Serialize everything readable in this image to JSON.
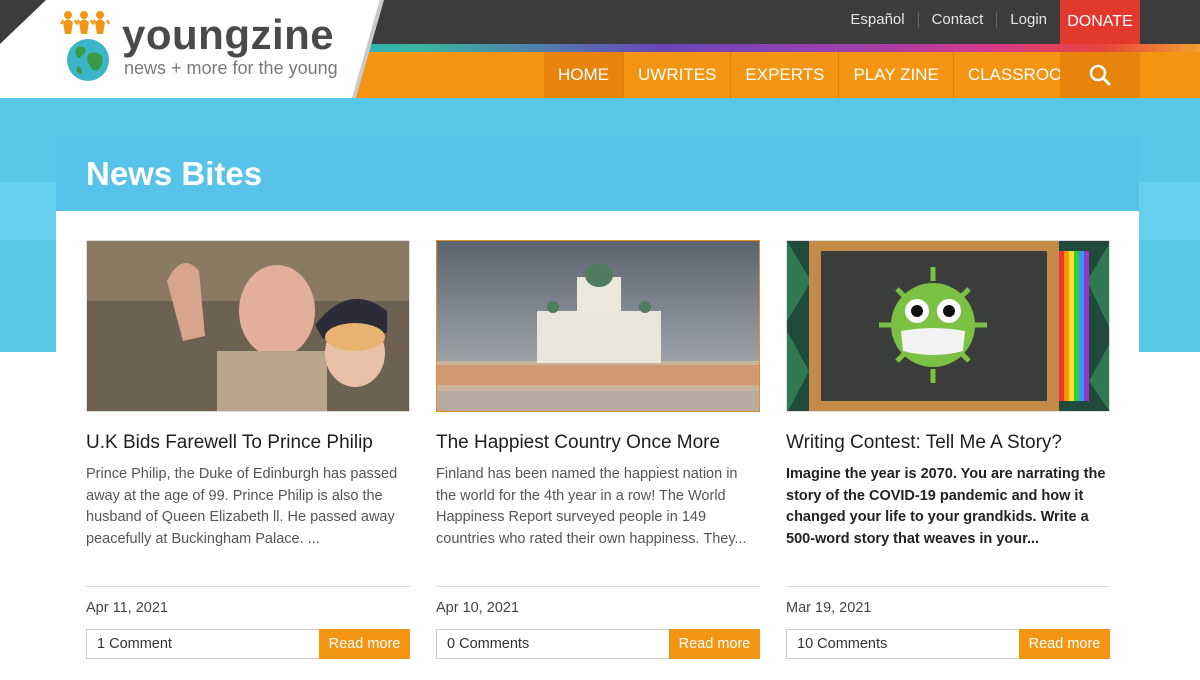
{
  "brand": {
    "name_part1": "young",
    "name_part2": "zine",
    "tagline": "news + more for the young"
  },
  "top_links": [
    "Español",
    "Contact",
    "Login"
  ],
  "donate_label": "DONATE",
  "nav": {
    "items": [
      "HOME",
      "UWRITES",
      "EXPERTS",
      "PLAY ZINE",
      "CLASSROOM"
    ],
    "active": "HOME",
    "search_icon": "search-icon"
  },
  "section": {
    "title": "News Bites"
  },
  "cards": [
    {
      "title": "U.K Bids Farewell To Prince Philip",
      "excerpt": "Prince Philip, the Duke of Edinburgh has passed away at the age of 99. Prince Philip is also the husband of Queen Elizabeth ll. He passed away peacefully at Buckingham Palace. ...",
      "date": "Apr 11, 2021",
      "comments": "1 Comment",
      "read_more": "Read more"
    },
    {
      "title": "The Happiest Country Once More",
      "excerpt": "Finland has been named the happiest nation in the world for the 4th year in a row! The World Happiness Report surveyed people in 149 countries who rated their own happiness. They...",
      "date": "Apr 10, 2021",
      "comments": "0 Comments",
      "read_more": "Read more"
    },
    {
      "title": "Writing Contest: Tell Me A Story?",
      "excerpt": "Imagine the year is 2070. You are narrating the story of the COVID-19 pandemic and how it changed your life to your grandkids. Write a 500-word story that weaves in your...",
      "date": "Mar 19, 2021",
      "comments": "10 Comments",
      "read_more": "Read more"
    }
  ],
  "colors": {
    "orange": "#f39512",
    "dark": "#3c3c3c",
    "red": "#e2382e",
    "sky": "#57c7e8"
  }
}
